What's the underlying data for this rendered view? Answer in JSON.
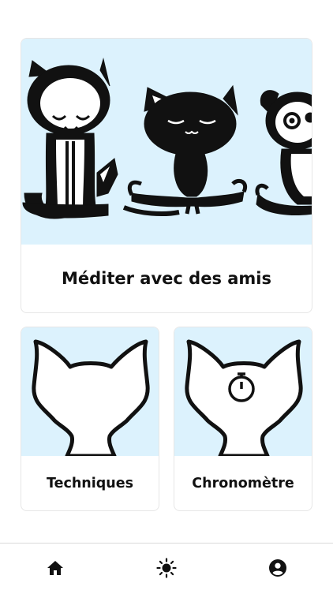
{
  "cards": {
    "main": {
      "label": "Méditer avec des amis"
    },
    "techniques": {
      "label": "Techniques"
    },
    "chrono": {
      "label": "Chronomètre"
    }
  },
  "tabbar": {
    "tabs": [
      {
        "icon": "home-icon",
        "active": true
      },
      {
        "icon": "sun-icon",
        "active": false
      },
      {
        "icon": "account-icon",
        "active": false
      }
    ]
  },
  "colors": {
    "art_background": "#dcf2fd",
    "ink": "#111111",
    "border": "#e6e6e6"
  }
}
